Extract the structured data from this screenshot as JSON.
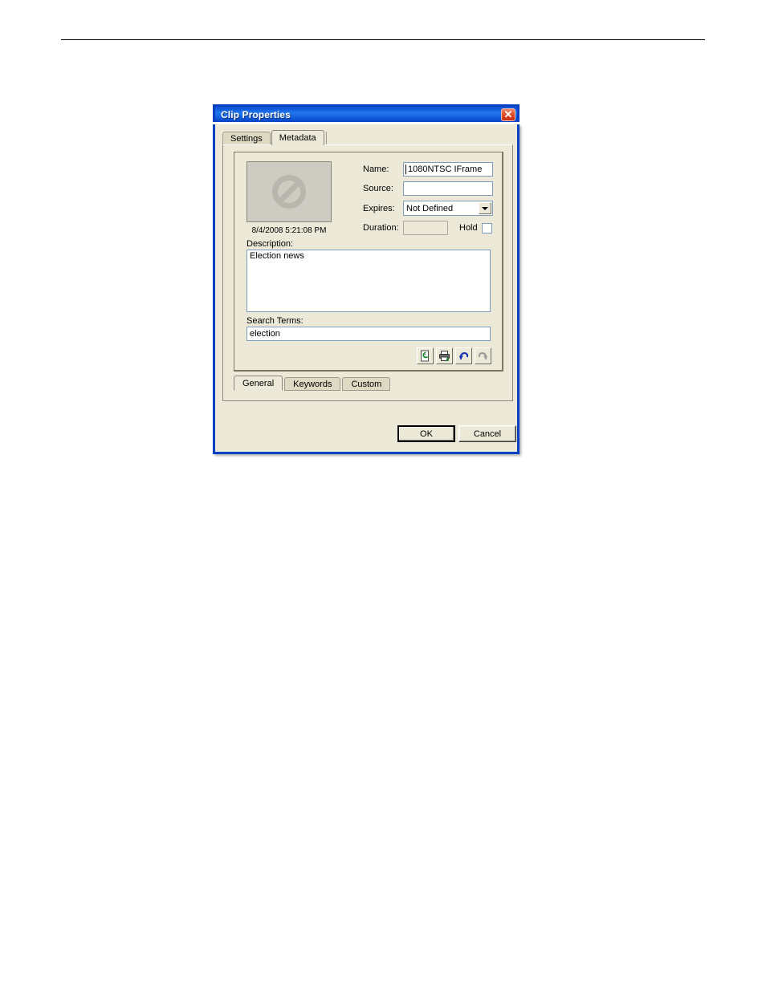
{
  "page": {
    "rule_present": true
  },
  "dialog": {
    "title": "Clip Properties",
    "close_icon": "close-icon",
    "close_label": "✕",
    "accent_color": "#0a41c4",
    "face_color": "#ece9d8",
    "tabs": [
      {
        "label": "Settings",
        "active": false
      },
      {
        "label": "Metadata",
        "active": true
      }
    ],
    "metadata": {
      "thumbnail": {
        "icon": "no-entry-icon",
        "timestamp": "8/4/2008 5:21:08 PM"
      },
      "fields": [
        {
          "label": "Name:",
          "value": "1080NTSC IFrame",
          "type": "text",
          "caret": true,
          "disabled": false
        },
        {
          "label": "Source:",
          "value": "",
          "type": "text",
          "caret": false,
          "disabled": false
        },
        {
          "label": "Expires:",
          "value": "Not Defined",
          "type": "combo",
          "options": [
            "Not Defined"
          ],
          "disabled": false
        },
        {
          "label": "Duration:",
          "value": "",
          "type": "text",
          "caret": false,
          "disabled": true
        }
      ],
      "hold": {
        "label": "Hold",
        "checked": false
      },
      "description": {
        "label": "Description:",
        "value": "Election news"
      },
      "search_terms": {
        "label": "Search Terms:",
        "value": "election"
      },
      "toolbar": [
        {
          "icon": "refresh-document-icon",
          "enabled": true
        },
        {
          "icon": "print-icon",
          "enabled": true
        },
        {
          "icon": "undo-icon",
          "enabled": true
        },
        {
          "icon": "redo-icon",
          "enabled": false
        }
      ],
      "subtabs": [
        {
          "label": "General",
          "active": true
        },
        {
          "label": "Keywords",
          "active": false
        },
        {
          "label": "Custom",
          "active": false
        }
      ]
    },
    "buttons": {
      "ok": "OK",
      "cancel": "Cancel"
    }
  }
}
